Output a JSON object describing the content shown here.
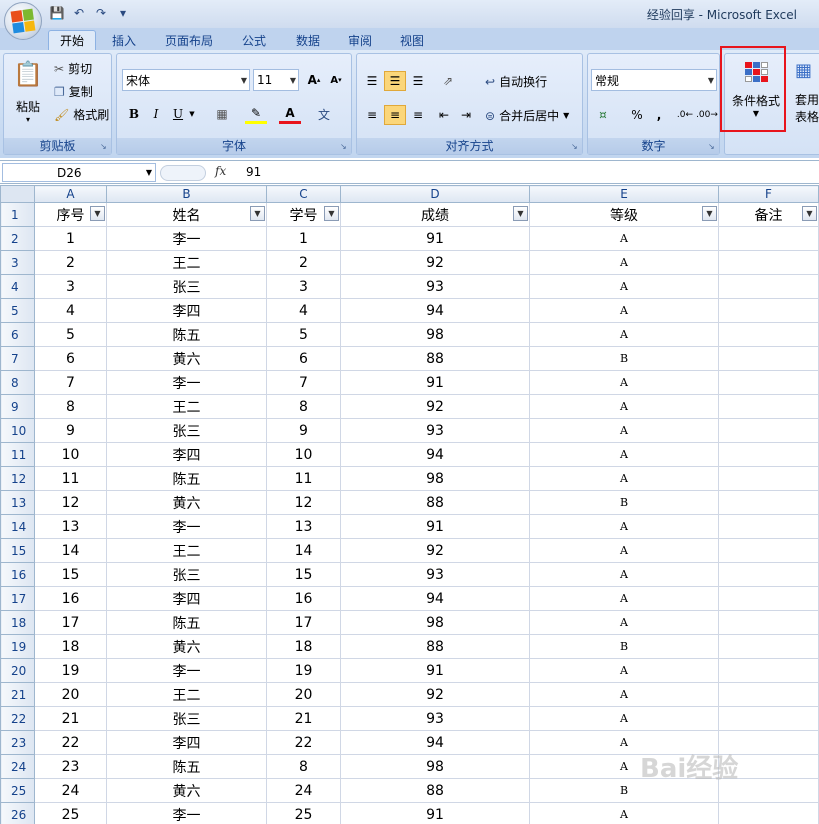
{
  "window": {
    "title": "经验回享 - Microsoft Excel"
  },
  "tabs": [
    "开始",
    "插入",
    "页面布局",
    "公式",
    "数据",
    "审阅",
    "视图"
  ],
  "ribbon": {
    "clipboard": {
      "paste": "粘贴",
      "cut": "剪切",
      "copy": "复制",
      "format_painter": "格式刷",
      "label": "剪贴板"
    },
    "font": {
      "name": "宋体",
      "size": "11",
      "label": "字体",
      "grow": "A",
      "shrink": "A",
      "bold": "B",
      "italic": "I",
      "underline": "U",
      "fill": "A",
      "color": "A",
      "phonetic": "文"
    },
    "alignment": {
      "wrap": "自动换行",
      "merge": "合并后居中",
      "label": "对齐方式"
    },
    "number": {
      "format": "常规",
      "percent": "%",
      "comma": ",",
      "label": "数字"
    },
    "styles": {
      "conditional_line1": "条件格式",
      "table_line1": "套用",
      "table_line2": "表格格"
    }
  },
  "formula_bar": {
    "cell_ref": "D26",
    "fx": "fx",
    "value": "91"
  },
  "columns": [
    "A",
    "B",
    "C",
    "D",
    "E",
    "F"
  ],
  "headers": [
    "序号",
    "姓名",
    "学号",
    "成绩",
    "等级",
    "备注"
  ],
  "rows": [
    [
      "1",
      "李一",
      "1",
      "91",
      "A",
      ""
    ],
    [
      "2",
      "王二",
      "2",
      "92",
      "A",
      ""
    ],
    [
      "3",
      "张三",
      "3",
      "93",
      "A",
      ""
    ],
    [
      "4",
      "李四",
      "4",
      "94",
      "A",
      ""
    ],
    [
      "5",
      "陈五",
      "5",
      "98",
      "A",
      ""
    ],
    [
      "6",
      "黄六",
      "6",
      "88",
      "B",
      ""
    ],
    [
      "7",
      "李一",
      "7",
      "91",
      "A",
      ""
    ],
    [
      "8",
      "王二",
      "8",
      "92",
      "A",
      ""
    ],
    [
      "9",
      "张三",
      "9",
      "93",
      "A",
      ""
    ],
    [
      "10",
      "李四",
      "10",
      "94",
      "A",
      ""
    ],
    [
      "11",
      "陈五",
      "11",
      "98",
      "A",
      ""
    ],
    [
      "12",
      "黄六",
      "12",
      "88",
      "B",
      ""
    ],
    [
      "13",
      "李一",
      "13",
      "91",
      "A",
      ""
    ],
    [
      "14",
      "王二",
      "14",
      "92",
      "A",
      ""
    ],
    [
      "15",
      "张三",
      "15",
      "93",
      "A",
      ""
    ],
    [
      "16",
      "李四",
      "16",
      "94",
      "A",
      ""
    ],
    [
      "17",
      "陈五",
      "17",
      "98",
      "A",
      ""
    ],
    [
      "18",
      "黄六",
      "18",
      "88",
      "B",
      ""
    ],
    [
      "19",
      "李一",
      "19",
      "91",
      "A",
      ""
    ],
    [
      "20",
      "王二",
      "20",
      "92",
      "A",
      ""
    ],
    [
      "21",
      "张三",
      "21",
      "93",
      "A",
      ""
    ],
    [
      "22",
      "李四",
      "22",
      "94",
      "A",
      ""
    ],
    [
      "23",
      "陈五",
      "8",
      "98",
      "A",
      ""
    ],
    [
      "24",
      "黄六",
      "24",
      "88",
      "B",
      ""
    ],
    [
      "25",
      "李一",
      "25",
      "91",
      "A",
      ""
    ]
  ],
  "watermark": "Bai经验"
}
